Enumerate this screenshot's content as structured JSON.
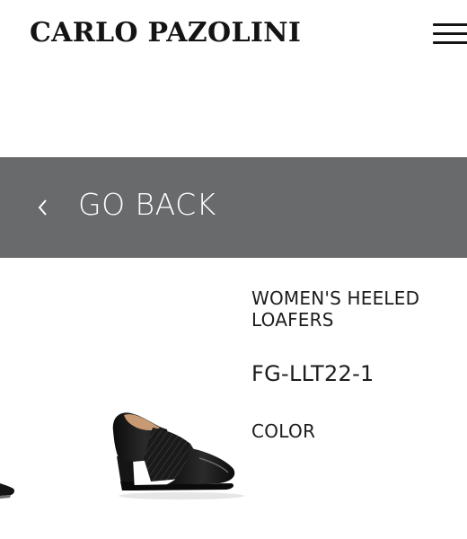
{
  "header": {
    "logo_text": "CARLO PAZOLINI",
    "menu_icon": "hamburger-menu-icon"
  },
  "back_bar": {
    "label": "GO BACK",
    "icon": "chevron-left-icon",
    "background_color": "#696a6c"
  },
  "product": {
    "name": "WOMEN'S HEELED LOAFERS",
    "sku": "FG-LLT22-1",
    "color_label": "COLOR"
  }
}
